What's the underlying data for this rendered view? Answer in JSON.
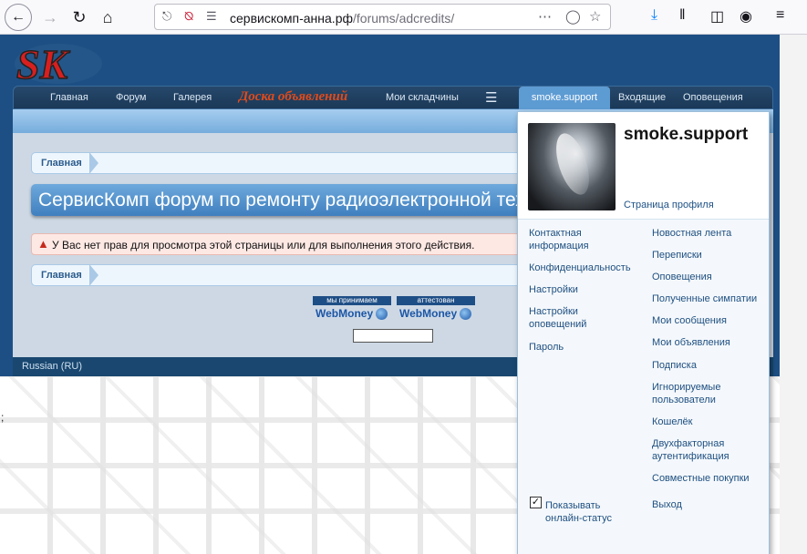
{
  "browser": {
    "url_host": "сервискомп-анна.рф",
    "url_path": "/forums/adcredits/",
    "icons": [
      "back-icon",
      "forward-icon",
      "reload-icon",
      "home-icon",
      "shield-icon",
      "blocked-camera-icon",
      "page-settings-icon",
      "more-dots-icon",
      "pocket-icon",
      "star-icon",
      "download-icon",
      "library-icon",
      "reader-icon",
      "account-icon",
      "hamburger-icon"
    ]
  },
  "logo": {
    "text": "SK"
  },
  "nav": {
    "items": [
      "Главная",
      "Форум",
      "Галерея",
      "Доска объявлений",
      "Мои складчины"
    ],
    "active": "smoke.support",
    "right": [
      "Входящие",
      "Оповещения"
    ]
  },
  "breadcrumb": {
    "home": "Главная"
  },
  "title": "СервисКомп форум по ремонту радиоэлектронной техники",
  "error": "У Вас нет прав для просмотра этой страницы или для выполнения этого действия.",
  "webmoney": [
    {
      "top": "мы принимаем",
      "label": "WebMoney"
    },
    {
      "top": "аттестован",
      "label": "WebMoney"
    }
  ],
  "footer": {
    "language": "Russian (RU)"
  },
  "user_menu": {
    "username": "smoke.support",
    "profile_link": "Страница профиля",
    "left": [
      "Контактная информация",
      "Конфиденциальность",
      "Настройки",
      "Настройки оповещений",
      "Пароль"
    ],
    "right": [
      "Новостная лента",
      "Переписки",
      "Оповещения",
      "Полученные симпатии",
      "Мои сообщения",
      "Мои объявления",
      "Подписка",
      "Игнорируемые пользователи",
      "Кошелёк",
      "Двухфакторная аутентификация",
      "Совместные покупки"
    ],
    "online_status": "Показывать онлайн-статус",
    "online_checked": true,
    "logout": "Выход"
  },
  "colors": {
    "accent": "#5d9bd3",
    "header": "#1d4f84",
    "board": "#e24a1a"
  }
}
